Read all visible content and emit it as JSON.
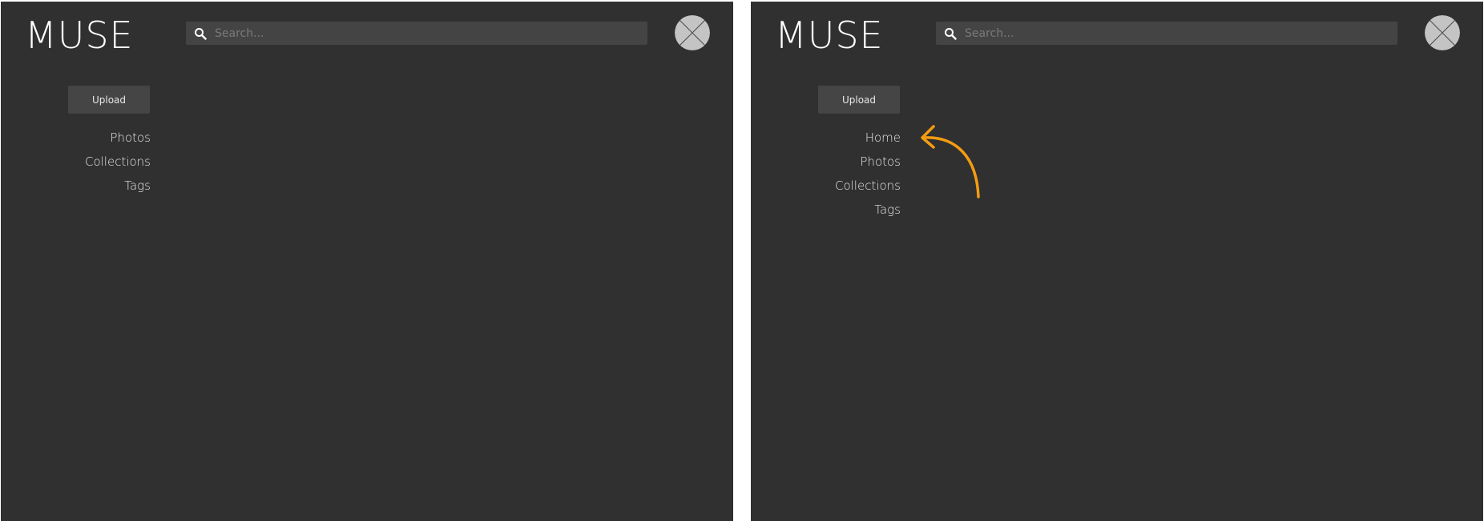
{
  "panels": [
    {
      "logo": "MUSE",
      "search": {
        "placeholder": "Search..."
      },
      "upload_label": "Upload",
      "nav_items": [
        "Photos",
        "Collections",
        "Tags"
      ]
    },
    {
      "logo": "MUSE",
      "search": {
        "placeholder": "Search..."
      },
      "upload_label": "Upload",
      "nav_items": [
        "Home",
        "Photos",
        "Collections",
        "Tags"
      ]
    }
  ],
  "icons": {
    "search": "search-icon",
    "avatar": "avatar-placeholder-icon",
    "annotation": "curved-arrow-icon"
  },
  "colors": {
    "background": "#303030",
    "search_bg": "#444444",
    "button_bg": "#454545",
    "text": "#e8e8e8",
    "avatar": "#c4c4c4",
    "accent_arrow": "#f39c12"
  }
}
